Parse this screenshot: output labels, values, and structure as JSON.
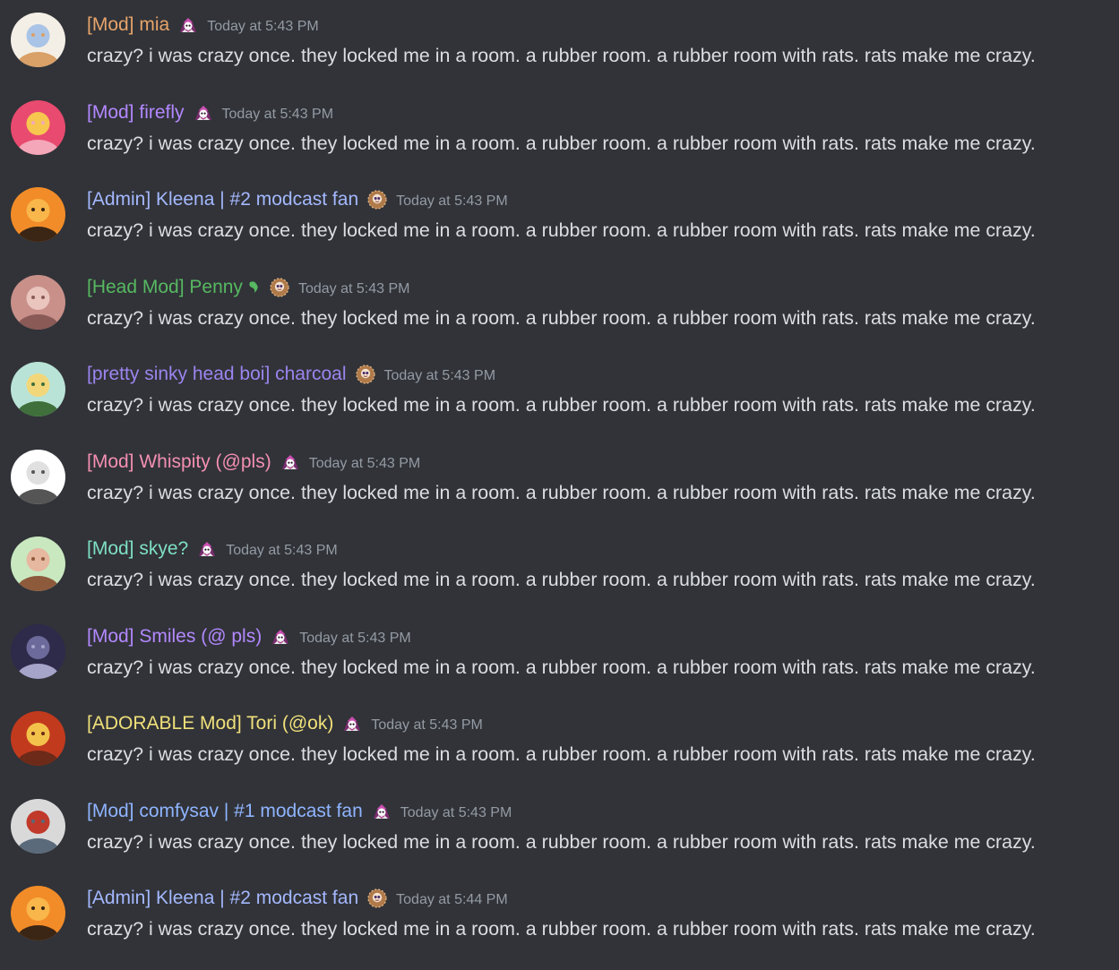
{
  "channel": {
    "messages": [
      {
        "username": "[Mod] mia",
        "color": "#e8a46a",
        "badge": "mod-role-icon",
        "timestamp": "Today at 5:43 PM",
        "text": "crazy? i was crazy once. they locked me in a room. a rubber room. a rubber room with rats. rats make me crazy.",
        "avatar_colors": [
          "#f4efe6",
          "#a9c4e6",
          "#d9a067"
        ]
      },
      {
        "username": "[Mod] firefly",
        "color": "#b388ff",
        "badge": "mod-role-icon",
        "timestamp": "Today at 5:43 PM",
        "text": "crazy? i was crazy once. they locked me in a room. a rubber room. a rubber room with rats. rats make me crazy.",
        "avatar_colors": [
          "#e94a6f",
          "#f7c64f",
          "#f3a7b9"
        ]
      },
      {
        "username": "[Admin] Kleena |  #2 modcast fan",
        "color": "#a4b8ff",
        "badge": "admin-role-icon",
        "timestamp": "Today at 5:43 PM",
        "text": "crazy? i was crazy once. they locked me in a room. a rubber room. a rubber room with rats. rats make me crazy.",
        "avatar_colors": [
          "#f28c28",
          "#f9b64a",
          "#3b2515"
        ]
      },
      {
        "username": "[Head Mod] Penny",
        "color": "#57b861",
        "badge": "admin-role-icon",
        "timestamp": "Today at 5:43 PM",
        "text": "crazy? i was crazy once. they locked me in a room. a rubber room. a rubber room with rats. rats make me crazy.",
        "avatar_colors": [
          "#c9908a",
          "#eac5be",
          "#8a5a56"
        ],
        "heart_color": "#57b861"
      },
      {
        "username": "[pretty sinky head boi] charcoal",
        "color": "#9c84ef",
        "badge": "admin-role-icon",
        "timestamp": "Today at 5:43 PM",
        "text": "crazy? i was crazy once. they locked me in a room. a rubber room. a rubber room with rats. rats make me crazy.",
        "avatar_colors": [
          "#b9e3d6",
          "#f2d77a",
          "#3f6f3a"
        ]
      },
      {
        "username": "[Mod] Whispity (@pls)",
        "color": "#f48fb1",
        "badge": "mod-role-icon",
        "timestamp": "Today at 5:43 PM",
        "text": "crazy? i was crazy once. they locked me in a room. a rubber room. a rubber room with rats. rats make me crazy.",
        "avatar_colors": [
          "#ffffff",
          "#e0e0e0",
          "#555555"
        ]
      },
      {
        "username": "[Mod] skye?",
        "color": "#7fe0c4",
        "badge": "mod-role-icon",
        "timestamp": "Today at 5:43 PM",
        "text": "crazy? i was crazy once. they locked me in a room. a rubber room. a rubber room with rats. rats make me crazy.",
        "avatar_colors": [
          "#c9e8c0",
          "#e6b8a0",
          "#8e5a3c"
        ]
      },
      {
        "username": "[Mod] Smiles (@ pls)",
        "color": "#b388ff",
        "badge": "mod-role-icon",
        "timestamp": "Today at 5:43 PM",
        "text": "crazy? i was crazy once. they locked me in a room. a rubber room. a rubber room with rats. rats make me crazy.",
        "avatar_colors": [
          "#2e2a4a",
          "#6b6a9a",
          "#a7a4c9"
        ]
      },
      {
        "username": "[ADORABLE Mod] Tori (@ok)",
        "color": "#f0e07a",
        "badge": "mod-role-icon",
        "timestamp": "Today at 5:43 PM",
        "text": "crazy? i was crazy once. they locked me in a room. a rubber room. a rubber room with rats. rats make me crazy.",
        "avatar_colors": [
          "#c23a1e",
          "#f3c24a",
          "#6e2a18"
        ]
      },
      {
        "username": "[Mod] comfysav | #1 modcast fan",
        "color": "#8fb4ff",
        "badge": "mod-role-icon",
        "timestamp": "Today at 5:43 PM",
        "text": "crazy? i was crazy once. they locked me in a room. a rubber room. a rubber room with rats. rats make me crazy.",
        "avatar_colors": [
          "#d9d9d9",
          "#c0392b",
          "#5a6a7a"
        ]
      },
      {
        "username": "[Admin] Kleena |  #2 modcast fan",
        "color": "#a4b8ff",
        "badge": "admin-role-icon",
        "timestamp": "Today at 5:44 PM",
        "text": "crazy? i was crazy once. they locked me in a room. a rubber room. a rubber room with rats. rats make me crazy.",
        "avatar_colors": [
          "#f28c28",
          "#f9b64a",
          "#3b2515"
        ]
      }
    ]
  }
}
